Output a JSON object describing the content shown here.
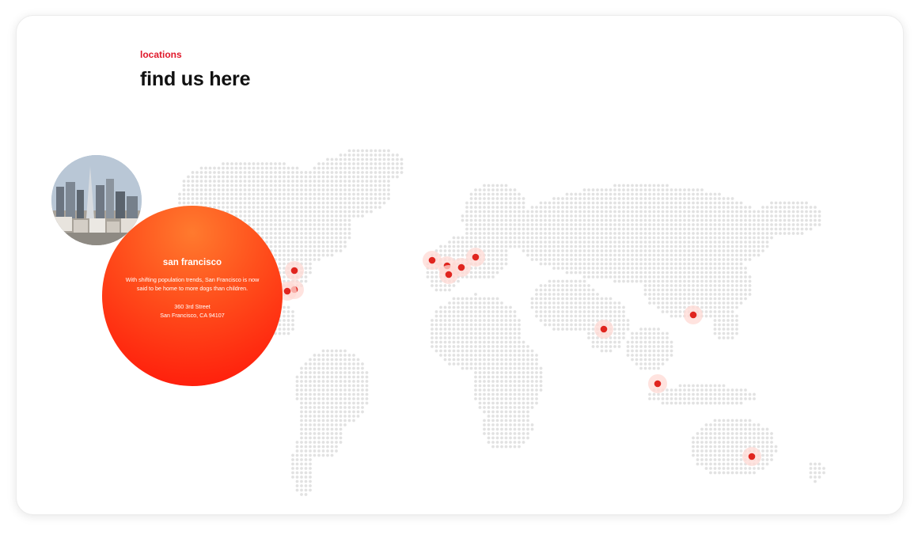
{
  "section": {
    "eyebrow": "locations",
    "title": "find us here"
  },
  "featured_location": {
    "city": "san francisco",
    "description": "With shifting population trends, San Francisco is now said to be home to more dogs than children.",
    "address_line1": "360 3rd Street",
    "address_line2": "San Francisco, CA 94107",
    "photo_icon": "city-skyline-photo"
  },
  "map": {
    "dot_color": "#e2e2e2",
    "marker_color": "#e0251f",
    "marker_halo_color": "#ffd9d4"
  },
  "colors": {
    "accent": "#e0192b",
    "heading": "#111111",
    "card_gradient_top": "#ff7a2e",
    "card_gradient_bottom": "#ff1208"
  }
}
